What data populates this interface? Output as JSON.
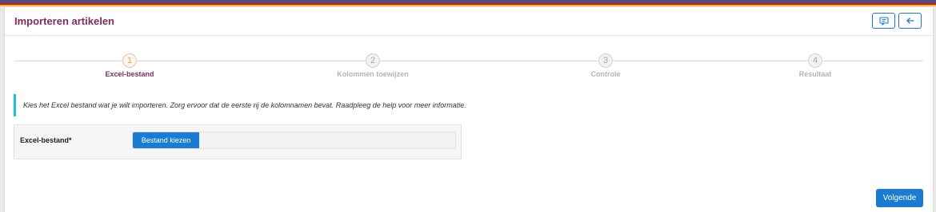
{
  "header": {
    "title": "Importeren artikelen",
    "feedback_icon": "comment-icon",
    "back_icon": "arrow-left-icon"
  },
  "stepper": {
    "steps": [
      {
        "number": "1",
        "label": "Excel-bestand",
        "active": true
      },
      {
        "number": "2",
        "label": "Kolommen toewijzen",
        "active": false
      },
      {
        "number": "3",
        "label": "Controle",
        "active": false
      },
      {
        "number": "4",
        "label": "Resultaat",
        "active": false
      }
    ]
  },
  "info": {
    "text": "Kies het Excel bestand wat je wilt importeren. Zorg ervoor dat de eerste rij de kolomnamen bevat. Raadpleeg de help voor meer informatie."
  },
  "form": {
    "file_label": "Excel-bestand*",
    "file_button": "Bestand kiezen",
    "file_value": ""
  },
  "footer": {
    "next_label": "Volgende"
  },
  "colors": {
    "accent": "#1a7bd2",
    "title": "#7d2e5e",
    "active_step_number": "#e8a33c",
    "info_border": "#19c2d6"
  }
}
